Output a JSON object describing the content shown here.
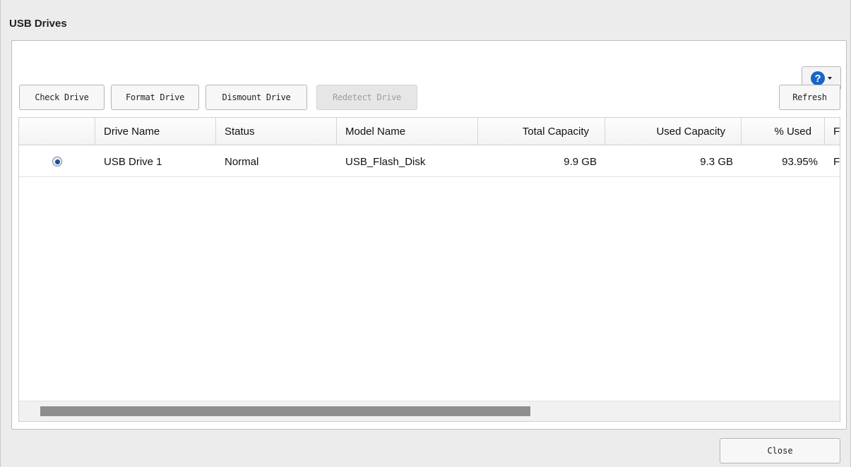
{
  "dialog": {
    "title": "USB Drives",
    "close_label": "Close"
  },
  "help": {
    "icon_glyph": "?",
    "icon": "help-icon",
    "accent": "#1a64c8"
  },
  "toolbar": {
    "check_label": "Check Drive",
    "format_label": "Format Drive",
    "dismount_label": "Dismount Drive",
    "redetect_label": "Redetect Drive",
    "refresh_label": "Refresh"
  },
  "table": {
    "columns": [
      {
        "key": "select",
        "label": ""
      },
      {
        "key": "drive_name",
        "label": "Drive Name"
      },
      {
        "key": "status",
        "label": "Status"
      },
      {
        "key": "model_name",
        "label": "Model Name"
      },
      {
        "key": "total_capacity",
        "label": "Total Capacity"
      },
      {
        "key": "used_capacity",
        "label": "Used Capacity"
      },
      {
        "key": "percent_used",
        "label": "% Used"
      },
      {
        "key": "extra",
        "label": "F"
      }
    ],
    "rows": [
      {
        "selected": true,
        "drive_name": "USB Drive 1",
        "status": "Normal",
        "model_name": "USB_Flash_Disk",
        "total_capacity": "9.9 GB",
        "used_capacity": "9.3 GB",
        "percent_used": "93.95%",
        "extra": "F"
      }
    ]
  }
}
